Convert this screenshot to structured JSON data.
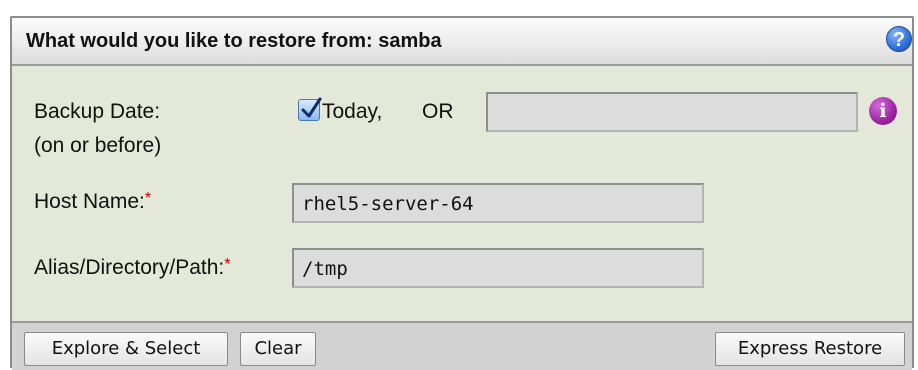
{
  "header": {
    "title": "What would you like to restore from: samba",
    "help_icon": "?"
  },
  "form": {
    "backup_date": {
      "label_line1": "Backup Date:",
      "label_line2": "(on or before)",
      "today_checked": true,
      "today_label": "Today,",
      "or_label": "OR",
      "date_value": "",
      "info_icon": "i"
    },
    "host_name": {
      "label": "Host Name:",
      "required_mark": "*",
      "value": "rhel5-server-64"
    },
    "path": {
      "label": "Alias/Directory/Path:",
      "required_mark": "*",
      "value": "/tmp"
    }
  },
  "footer": {
    "explore_label": "Explore & Select",
    "clear_label": "Clear",
    "express_restore_label": "Express Restore"
  },
  "colors": {
    "panel_bg": "#e3e8d8",
    "footer_bg": "#d2d2d2",
    "required": "#d00000",
    "help_icon": "#2f6fd6",
    "info_icon": "#99209e"
  }
}
